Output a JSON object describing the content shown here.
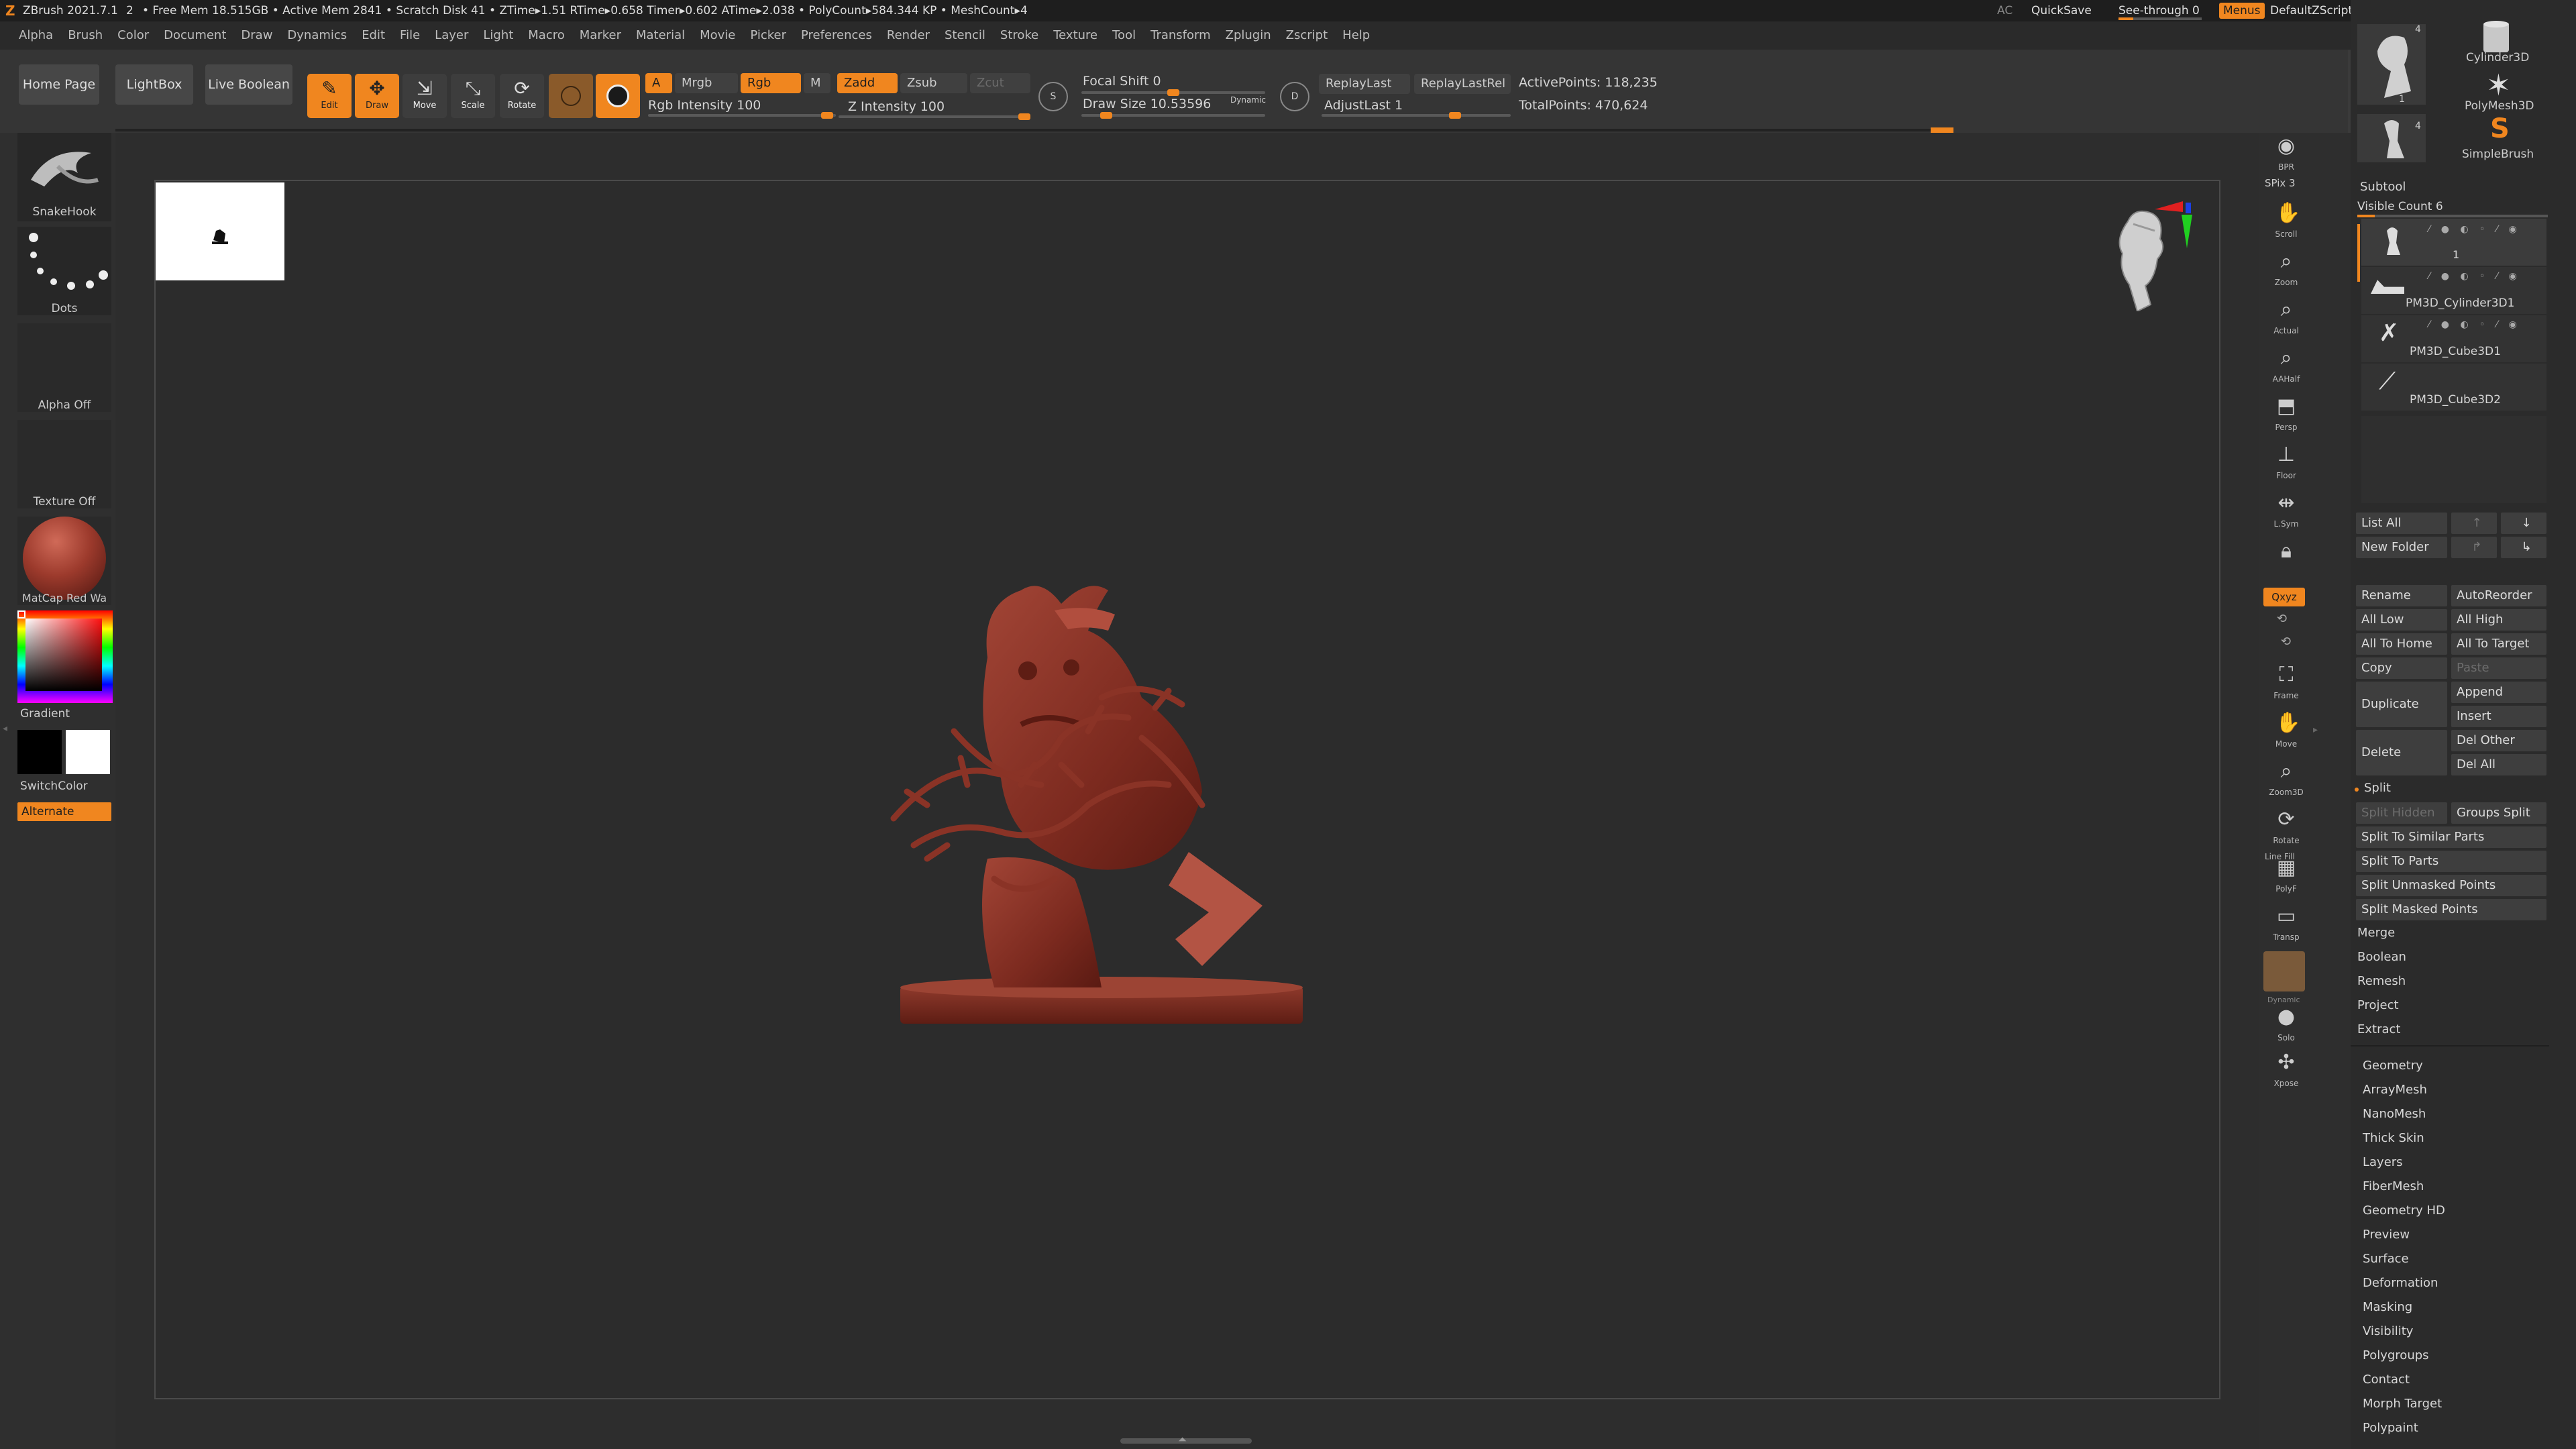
{
  "titlebar": {
    "app_title": "ZBrush 2021.7.1",
    "index": "2",
    "status": "• Free Mem 18.515GB • Active Mem 2841 • Scratch Disk 41 • ZTime▸1.51 RTime▸0.658 Timer▸0.602 ATime▸2.038 • PolyCount▸584.344 KP • MeshCount▸4",
    "ac_label": "AC",
    "quicksave_label": "QuickSave",
    "seethrough_label": "See-through 0",
    "menus_label": "Menus",
    "script_label": "DefaultZScript"
  },
  "menu": [
    "Alpha",
    "Brush",
    "Color",
    "Document",
    "Draw",
    "Dynamics",
    "Edit",
    "File",
    "Layer",
    "Light",
    "Macro",
    "Marker",
    "Material",
    "Movie",
    "Picker",
    "Preferences",
    "Render",
    "Stencil",
    "Stroke",
    "Texture",
    "Tool",
    "Transform",
    "Zplugin",
    "Zscript",
    "Help"
  ],
  "toolbar": {
    "home": "Home Page",
    "lightbox": "LightBox",
    "live_boolean": "Live Boolean",
    "edit": "Edit",
    "draw": "Draw",
    "move": "Move",
    "scale": "Scale",
    "rotate": "Rotate",
    "a": "A",
    "mrgb": "Mrgb",
    "rgb": "Rgb",
    "m": "M",
    "rgb_intensity": "Rgb Intensity 100",
    "zadd": "Zadd",
    "zsub": "Zsub",
    "zcut": "Zcut",
    "z_intensity": "Z Intensity 100",
    "focal_shift": "Focal Shift 0",
    "draw_size": "Draw Size 10.53596",
    "dynamic": "Dynamic",
    "replay_last": "ReplayLast",
    "replay_last_rel": "ReplayLastRel",
    "adjust_last": "AdjustLast 1",
    "active_points": "ActivePoints: 118,235",
    "total_points": "TotalPoints: 470,624",
    "accent_color": "#f0861f"
  },
  "lefttray": {
    "brush": "SnakeHook",
    "stroke": "Dots",
    "alpha": "Alpha Off",
    "texture": "Texture Off",
    "material": "MatCap Red Wa",
    "gradient": "Gradient",
    "switch_color": "SwitchColor",
    "alternate": "Alternate",
    "main_color": "#000000",
    "secondary_color": "#ffffff"
  },
  "shelf": {
    "bpr": "BPR",
    "spix": "SPix 3",
    "scroll": "Scroll",
    "zoom": "Zoom",
    "actual": "Actual",
    "aahalf": "AAHalf",
    "persp": "Persp",
    "floor": "Floor",
    "lsym": "L.Sym",
    "xyz": "Qxyz",
    "frame": "Frame",
    "move": "Move",
    "zoom3d": "Zoom3D",
    "rotate": "Rotate",
    "line_fill": "Line Fill",
    "polyf": "PolyF",
    "transp": "Transp",
    "dynamic": "Dynamic",
    "solo": "Solo",
    "xpose": "Xpose"
  },
  "toolthumbs": {
    "count_a": "4",
    "index_a": "1",
    "count_b": "4",
    "cylinder": "Cylinder3D",
    "polymesh": "PolyMesh3D",
    "simplebrush": "SimpleBrush"
  },
  "subtool": {
    "title": "Subtool",
    "visible_count": "Visible Count 6",
    "items": [
      "1",
      "PM3D_Cylinder3D1",
      "PM3D_Cube3D1",
      "PM3D_Cube3D2"
    ],
    "list_all": "List All",
    "new_folder": "New Folder",
    "rename": "Rename",
    "auto_reorder": "AutoReorder",
    "all_low": "All Low",
    "all_high": "All High",
    "all_to_home": "All To Home",
    "all_to_target": "All To Target",
    "copy": "Copy",
    "paste": "Paste",
    "duplicate": "Duplicate",
    "append": "Append",
    "insert": "Insert",
    "delete": "Delete",
    "del_other": "Del Other",
    "del_all": "Del All",
    "split": "Split",
    "split_hidden": "Split Hidden",
    "groups_split": "Groups Split",
    "split_similar": "Split To Similar Parts",
    "split_to_parts": "Split To Parts",
    "split_unmasked": "Split Unmasked Points",
    "split_masked": "Split Masked Points",
    "merge": "Merge",
    "boolean": "Boolean",
    "remesh": "Remesh",
    "project": "Project",
    "extract": "Extract"
  },
  "toolmenu": [
    "Geometry",
    "ArrayMesh",
    "NanoMesh",
    "Thick Skin",
    "Layers",
    "FiberMesh",
    "Geometry HD",
    "Preview",
    "Surface",
    "Deformation",
    "Masking",
    "Visibility",
    "Polygroups",
    "Contact",
    "Morph Target",
    "Polypaint"
  ]
}
